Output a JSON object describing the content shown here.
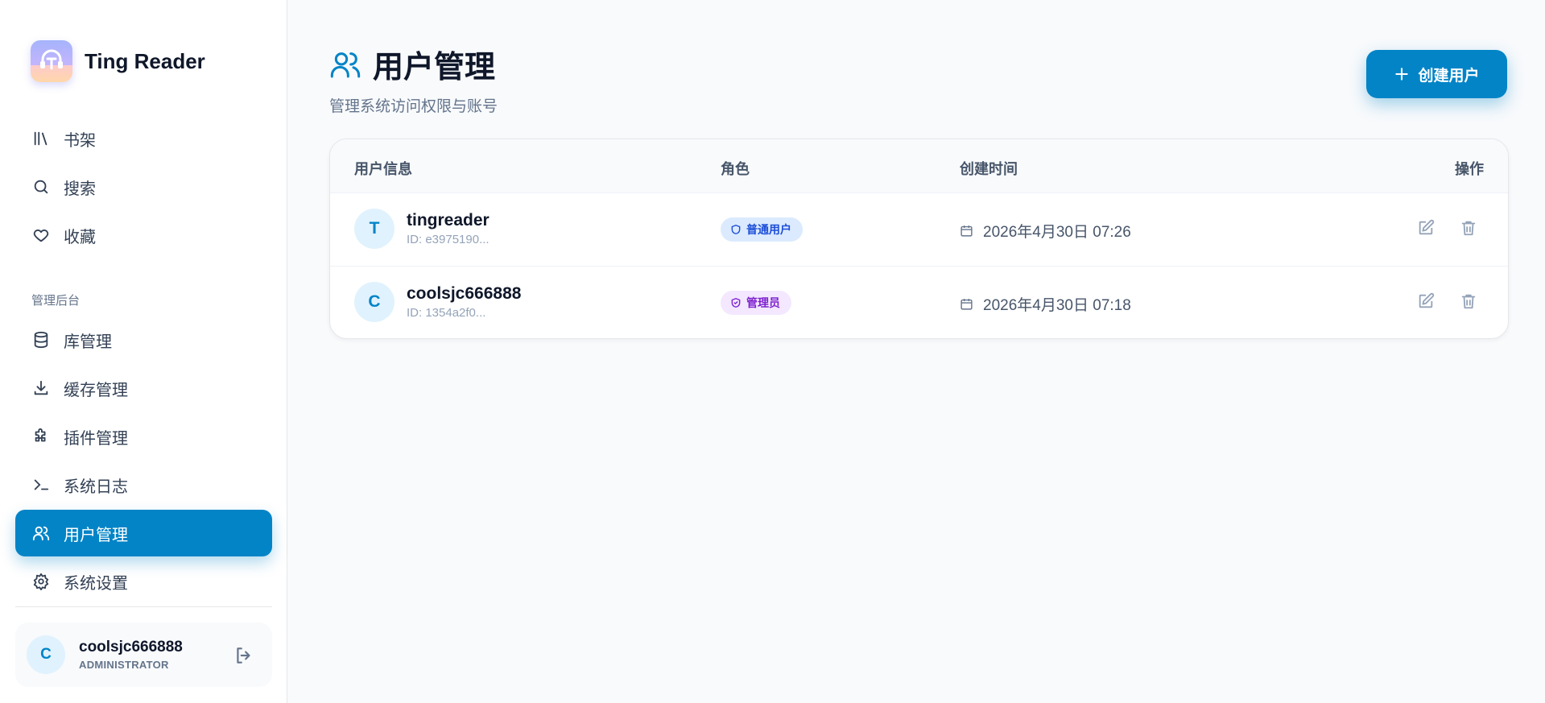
{
  "app": {
    "name": "Ting Reader"
  },
  "sidebar": {
    "nav_main": [
      {
        "label": "书架",
        "icon": "library-icon"
      },
      {
        "label": "搜索",
        "icon": "search-icon"
      },
      {
        "label": "收藏",
        "icon": "heart-icon"
      }
    ],
    "section_label": "管理后台",
    "nav_admin": [
      {
        "label": "库管理",
        "icon": "database-icon"
      },
      {
        "label": "缓存管理",
        "icon": "download-icon"
      },
      {
        "label": "插件管理",
        "icon": "puzzle-icon"
      },
      {
        "label": "系统日志",
        "icon": "terminal-icon"
      },
      {
        "label": "用户管理",
        "icon": "users-icon",
        "active": true
      },
      {
        "label": "系统设置",
        "icon": "gear-icon"
      }
    ],
    "current_user": {
      "initial": "C",
      "name": "coolsjc666888",
      "role": "ADMINISTRATOR"
    }
  },
  "page": {
    "title": "用户管理",
    "subtitle": "管理系统访问权限与账号",
    "create_button": "创建用户"
  },
  "table": {
    "headers": {
      "user_info": "用户信息",
      "role": "角色",
      "created": "创建时间",
      "actions": "操作"
    },
    "rows": [
      {
        "initial": "T",
        "name": "tingreader",
        "id": "ID: e3975190...",
        "role": "普通用户",
        "role_type": "user",
        "created": "2026年4月30日 07:26"
      },
      {
        "initial": "C",
        "name": "coolsjc666888",
        "id": "ID: 1354a2f0...",
        "role": "管理员",
        "role_type": "admin",
        "created": "2026年4月30日 07:18"
      }
    ]
  },
  "colors": {
    "accent": "#0284c7",
    "user_badge": "#dbeafe",
    "admin_badge": "#f3e8ff"
  }
}
